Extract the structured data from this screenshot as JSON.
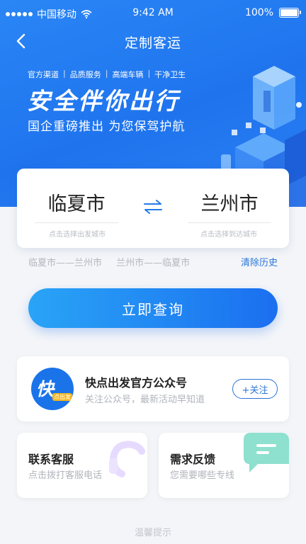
{
  "status_bar": {
    "carrier": "中国移动",
    "time": "9:42 AM",
    "battery": "100%"
  },
  "nav": {
    "title": "定制客运",
    "back_icon": "chevron-left-icon"
  },
  "banner": {
    "tags": [
      "官方渠道",
      "品质服务",
      "高端车辆",
      "干净卫生"
    ],
    "slogan": "安全伴你出行",
    "subslogan": "国企重磅推出 为您保驾护航"
  },
  "search": {
    "from_city": "临夏市",
    "from_hint": "点击选择出发城市",
    "to_city": "兰州市",
    "to_hint": "点击选择到达城市",
    "swap_icon": "swap-arrows-icon"
  },
  "history": {
    "items": [
      "临夏市——兰州市",
      "兰州市——临夏市"
    ],
    "clear_label": "清除历史"
  },
  "query_button": "立即查询",
  "official_account": {
    "logo_text": "快",
    "logo_sub": "点出发",
    "title": "快点出发官方公众号",
    "subtitle": "关注公众号，最新活动早知道",
    "follow_label": "+关注"
  },
  "services": [
    {
      "title": "联系客服",
      "subtitle": "点击拨打客服电话",
      "icon": "headset-icon"
    },
    {
      "title": "需求反馈",
      "subtitle": "您需要哪些专线",
      "icon": "chat-bubble-icon"
    }
  ],
  "footer": {
    "tips": "温馨提示"
  },
  "colors": {
    "primary": "#1f74ee",
    "link": "#2a74d8",
    "hint": "#b0b4bb"
  }
}
